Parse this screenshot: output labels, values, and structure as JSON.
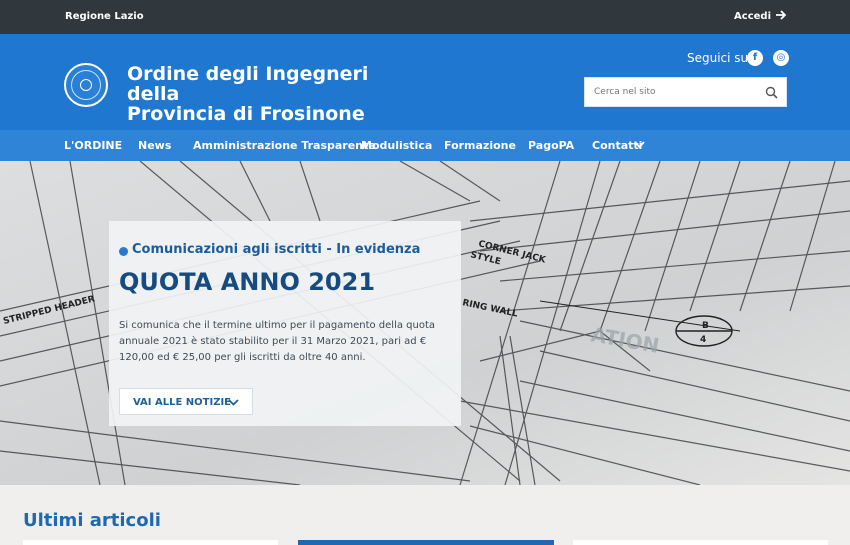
{
  "topbar": {
    "region": "Regione Lazio",
    "login_label": "Accedi",
    "login_icon": "arrow-right-icon"
  },
  "header": {
    "title_line1": "Ordine degli Ingegneri della",
    "title_line2": "Provincia di Frosinone",
    "follow_label": "Seguici su",
    "social": [
      {
        "name": "facebook-icon",
        "glyph": "f"
      },
      {
        "name": "web-icon",
        "glyph": "◎"
      }
    ],
    "search_placeholder": "Cerca nel sito"
  },
  "nav": {
    "items": [
      "L'ORDINE",
      "News",
      "Amministrazione Trasparente",
      "Modulistica",
      "Formazione",
      "PagoPA",
      "Contatti"
    ]
  },
  "hero": {
    "category": "Comunicazioni agli iscritti - In evidenza",
    "headline": "QUOTA ANNO 2021",
    "summary": "Si comunica che  il termine ultimo per il pagamento della quota annuale 2021 è stato stabilito per il 31 Marzo 2021, pari ad € 120,00 ed € 25,00 per gli iscritti da oltre 40 anni.",
    "button_label": "VAI ALLE NOTIZIE",
    "blueprint_labels": [
      "CORNER JACK",
      "STYLE",
      "RING WALL",
      "STRIPPED HEADER",
      "ATION"
    ]
  },
  "latest": {
    "title": "Ultimi articoli"
  },
  "colors": {
    "topbar": "#30373d",
    "header": "#1f77cf",
    "nav": "#2f84d8",
    "accent": "#154b80"
  }
}
